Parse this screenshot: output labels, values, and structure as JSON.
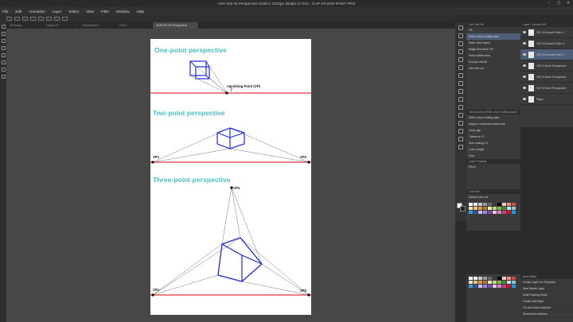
{
  "window": {
    "title": "ASH 002 06 Perspective (1920 x 3200px 350dpi 27.6%)  -  CLIP STUDIO PAINT PRO",
    "controls": [
      "–",
      "▢",
      "✕"
    ]
  },
  "menu": [
    "File",
    "Edit",
    "Animation",
    "Layer",
    "Select",
    "View",
    "Filter",
    "Window",
    "Help"
  ],
  "tabs": [
    {
      "label": "16 Rotary",
      "active": false
    },
    {
      "label": "Cards 02*",
      "active": false
    },
    {
      "label": "Screenshot 1",
      "active": false
    },
    {
      "label": "CEL(*",
      "active": false
    },
    {
      "label": "ASH 002 06 Perspective",
      "active": true
    }
  ],
  "artwork": {
    "one_point": {
      "title": "One-point perspective",
      "vp_label": "Vanishing Point (VP)"
    },
    "two_point": {
      "title": "Two-point perspective",
      "vp1": "VP1",
      "vp2": "VP2"
    },
    "three_point": {
      "title": "Three-point perspective",
      "vp1": "VP1",
      "vp2": "VP2",
      "vp3": "VP3"
    }
  },
  "sub_tool": {
    "header": "Sub Tool Fill",
    "items": [
      {
        "label": "Fill",
        "selected": false
      },
      {
        "label": "Refer only to editing layer",
        "selected": true
      },
      {
        "label": "Refer other layers",
        "selected": false
      },
      {
        "label": "Magic Enclosure Fill",
        "selected": false
      },
      {
        "label": "Paint unfilled area",
        "selected": false
      },
      {
        "label": "Enclose and fill",
        "selected": false
      },
      {
        "label": "Add sub tool",
        "selected": false
      }
    ]
  },
  "tool_property": {
    "header": "Tool property [Refer only to editing layer]",
    "name": "Refer only to editing layer",
    "options": [
      "Apply to connected pixels only",
      "Close gap",
      "Tolerance",
      "Area scaling",
      "Color margin",
      "Area"
    ],
    "tolerance_value": "12",
    "area_scaling_value": "2.0"
  },
  "layer_property": {
    "header": "Layer Property",
    "effect": "Effect"
  },
  "layers": {
    "header": "Layer",
    "blend": "Normal",
    "opacity": "100",
    "items": [
      {
        "label": "100 % Normal Folder 2",
        "selected": false
      },
      {
        "label": "100 % Normal Folder 3",
        "selected": false
      },
      {
        "label": "100 % Normal Folder 1",
        "selected": true
      },
      {
        "label": "100 % Norm Perspective",
        "selected": false
      },
      {
        "label": "100 % Norm Perspective",
        "selected": false
      },
      {
        "label": "100 % Norm Perspective",
        "selected": false
      },
      {
        "label": "Paper",
        "selected": false
      }
    ]
  },
  "color_set": {
    "header": "Color Set",
    "name": "Default color set"
  },
  "auto_action": {
    "header": "Auto Action",
    "set_name": "Create Layer-For Proposes",
    "items": [
      "New Border Layer",
      "Draft Drawing Detail",
      "Create draft layer",
      "Cut and move selection",
      "Stretch the selection"
    ]
  },
  "palette": [
    "#ffffff",
    "#f2f2f2",
    "#c8c8c8",
    "#9a9a9a",
    "#6a6a6a",
    "#3d3d3d",
    "#000000",
    "#f7c8c0",
    "#e88e80",
    "#d44a3a",
    "#f5e3c0",
    "#e8c48a",
    "#d6a04f",
    "#b57a2a",
    "#e8f0c0",
    "#c0d88a",
    "#8ab84a",
    "#4a8a2a",
    "#c0e8f0",
    "#8ac8e0",
    "#4a9ad0",
    "#2a5aa0",
    "#d0c0f0",
    "#a08ad6",
    "#7050b0",
    "#f0c0e0",
    "#d88ac0",
    "#b04a90",
    "#ff0000",
    "#00a0ff"
  ],
  "accent": {
    "selected": "#4f5e78",
    "horizon": "#e0363d",
    "cube": "#1a2ad8",
    "title": "#4bbfc3"
  }
}
